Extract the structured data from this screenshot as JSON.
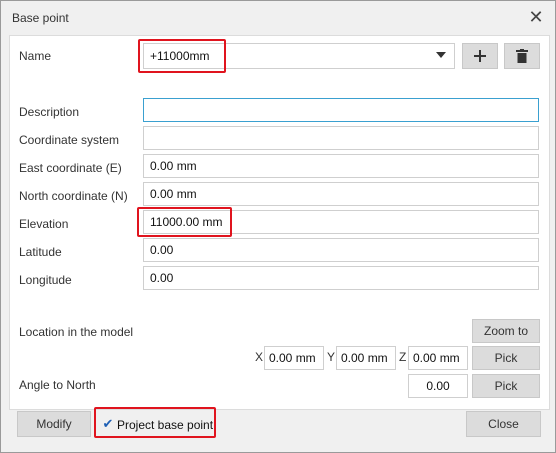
{
  "window": {
    "title": "Base point"
  },
  "name": {
    "label": "Name",
    "value": "+11000mm"
  },
  "fields": [
    {
      "label": "Description",
      "value": ""
    },
    {
      "label": "Coordinate system",
      "value": ""
    },
    {
      "label": "East coordinate  (E)",
      "value": "0.00 mm"
    },
    {
      "label": "North coordinate  (N)",
      "value": "0.00 mm"
    },
    {
      "label": "Elevation",
      "value": "11000.00 mm"
    },
    {
      "label": "Latitude",
      "value": "0.00"
    },
    {
      "label": "Longitude",
      "value": "0.00"
    }
  ],
  "location": {
    "label": "Location in the model",
    "zoom_label": "Zoom to",
    "x_label": "X",
    "x_value": "0.00 mm",
    "y_label": "Y",
    "y_value": "0.00 mm",
    "z_label": "Z",
    "z_value": "0.00 mm",
    "pick_label": "Pick"
  },
  "angle": {
    "label": "Angle to North",
    "value": "0.00",
    "pick_label": "Pick"
  },
  "footer": {
    "modify_label": "Modify",
    "checkbox_label": "Project base point",
    "checkbox_checked": true,
    "close_label": "Close"
  },
  "icons": {
    "add": "plus-icon",
    "delete": "trash-icon",
    "dropdown": "chevron-down-icon",
    "close": "close-icon"
  },
  "colors": {
    "highlight": "#e0141e",
    "focus": "#3aa0d0",
    "check": "#1e5fb4"
  }
}
